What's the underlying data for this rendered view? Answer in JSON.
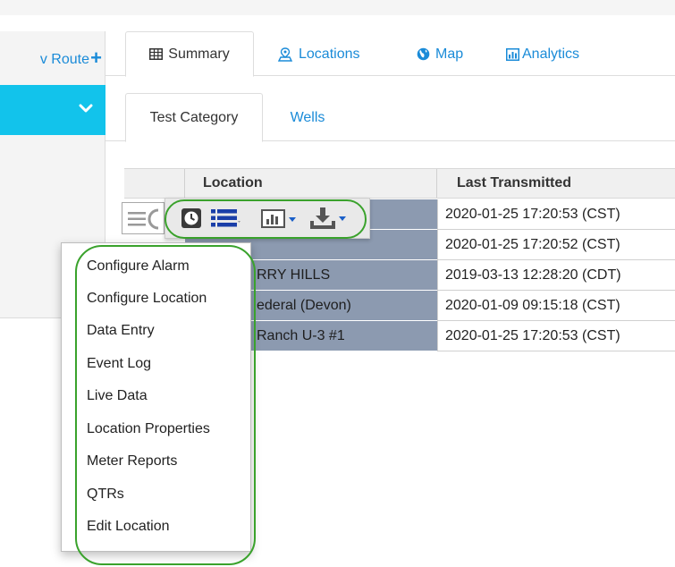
{
  "sidebar": {
    "new_route_label": "v Route",
    "new_route_icon": "plus-icon",
    "select_icon": "chevron-down-icon",
    "select_color": "#12c3eb"
  },
  "main_tabs": [
    {
      "label": "Summary",
      "icon": "table-icon",
      "active": true
    },
    {
      "label": "Locations",
      "icon": "location-icon",
      "active": false
    },
    {
      "label": "Map",
      "icon": "globe-icon",
      "active": false
    },
    {
      "label": "Analytics",
      "icon": "bar-chart-icon",
      "active": false
    }
  ],
  "sub_tabs": [
    {
      "label": "Test Category",
      "active": true
    },
    {
      "label": "Wells",
      "active": false
    }
  ],
  "grid": {
    "columns": [
      "Location",
      "Last Transmitted"
    ],
    "rows": [
      {
        "location": "",
        "last_transmitted": "2020-01-25 17:20:53 (CST)"
      },
      {
        "location": "",
        "last_transmitted": "2020-01-25 17:20:52 (CST)"
      },
      {
        "location": "RRY HILLS",
        "last_transmitted": "2019-03-13 12:28:20 (CDT)"
      },
      {
        "location": "ederal (Devon)",
        "last_transmitted": "2020-01-09 09:15:18 (CST)"
      },
      {
        "location": "Ranch U-3 #1",
        "last_transmitted": "2020-01-25 17:20:53 (CST)"
      }
    ],
    "location_cell_color": "#8c9ab0"
  },
  "toolbar": {
    "icons": [
      "history-icon",
      "list-icon",
      "chart-dropdown-icon",
      "download-dropdown-icon"
    ],
    "accent": "#3aa22c"
  },
  "dropdown_menu": {
    "items": [
      "Configure Alarm",
      "Configure Location",
      "Data Entry",
      "Event Log",
      "Live Data",
      "Location Properties",
      "Meter Reports",
      "QTRs",
      "Edit Location"
    ]
  },
  "colors": {
    "link": "#1a8bd8",
    "highlight_outline": "#3aa22c"
  }
}
